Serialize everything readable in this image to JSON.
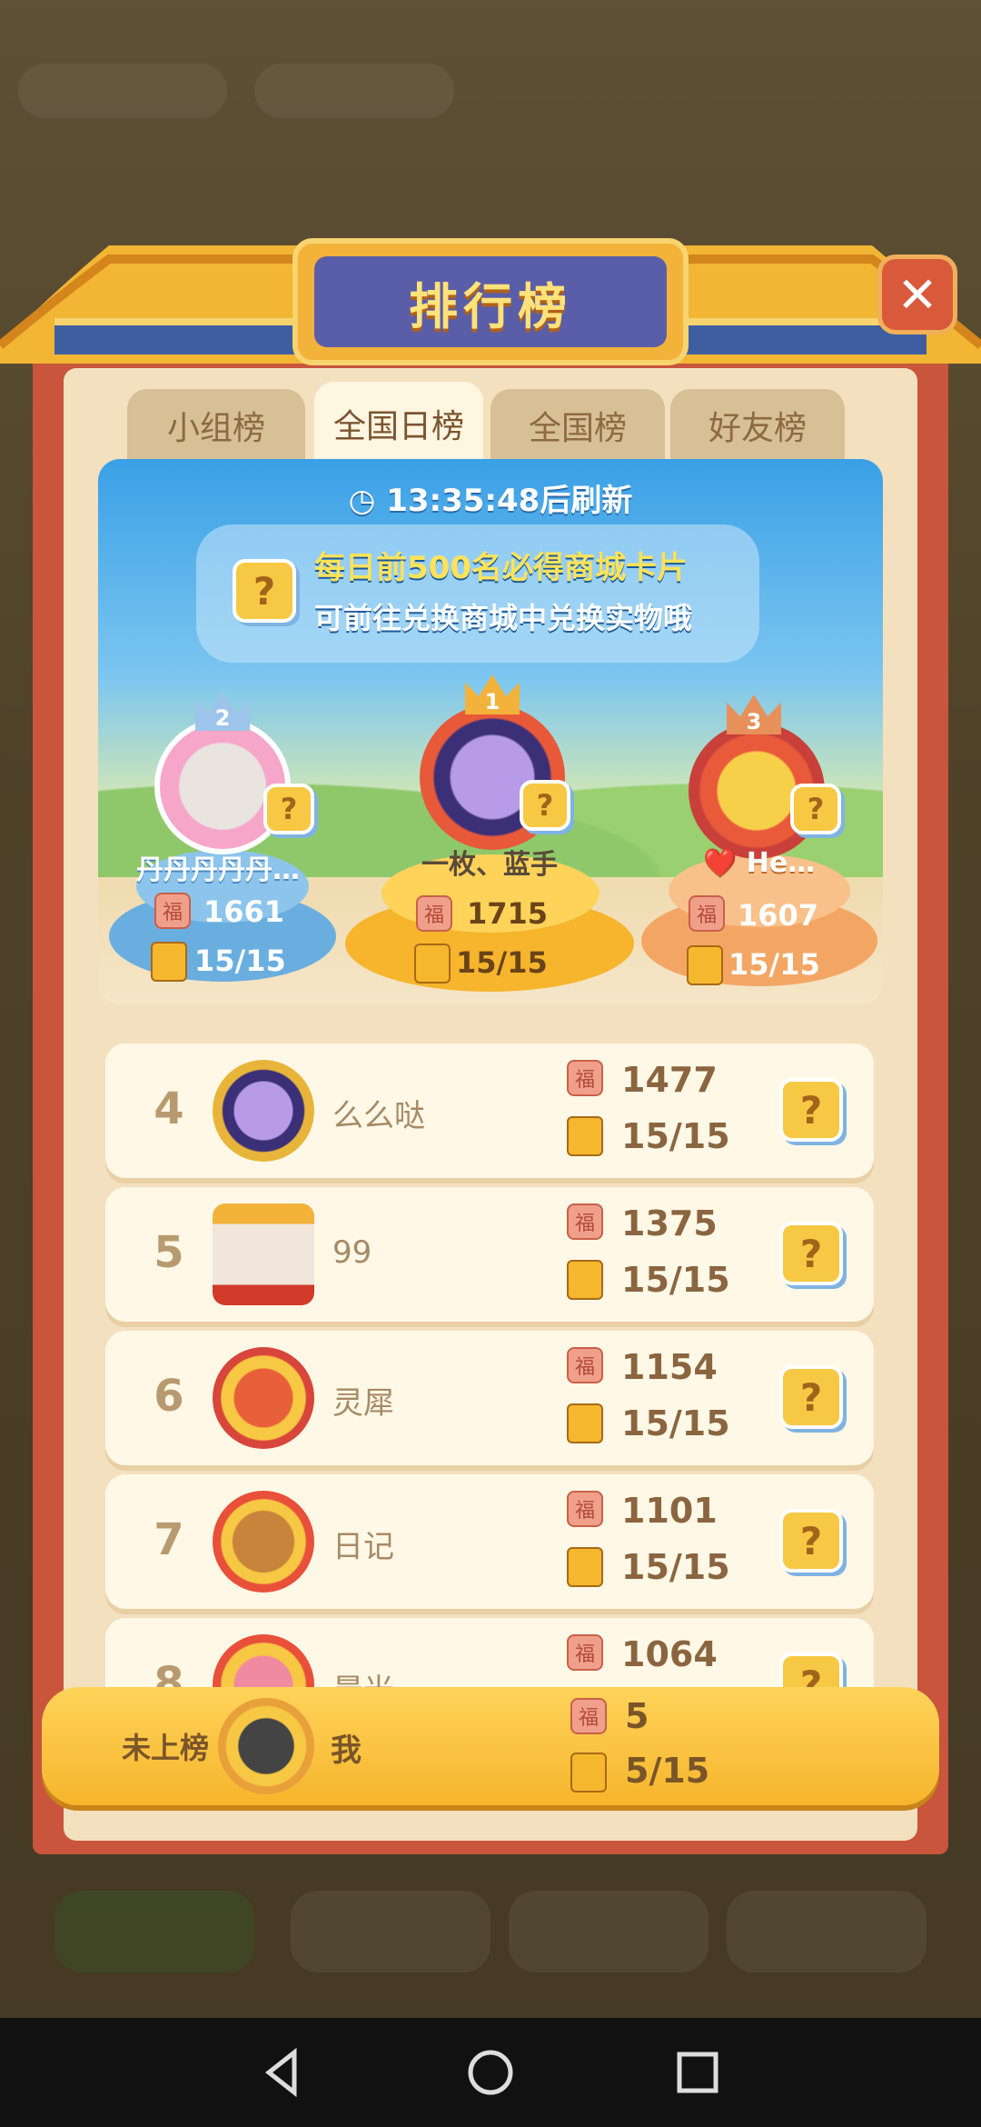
{
  "title": "排行榜",
  "close_label": "✕",
  "tabs": [
    {
      "label": "小组榜"
    },
    {
      "label": "全国日榜"
    },
    {
      "label": "全国榜"
    },
    {
      "label": "好友榜"
    }
  ],
  "refresh": "13:35:48后刷新",
  "notice": {
    "line1": "每日前500名必得商城卡片",
    "line2": "可前往兑换商城中兑换实物哦"
  },
  "question_mark": "?",
  "fu_char": "福",
  "podium": [
    {
      "rank": "2",
      "name": "丹丹丹丹丹…",
      "score": "1661",
      "progress": "15/15"
    },
    {
      "rank": "1",
      "name": "一枚、蓝手",
      "score": "1715",
      "progress": "15/15"
    },
    {
      "rank": "3",
      "name": "❤️ He…",
      "score": "1607",
      "progress": "15/15"
    }
  ],
  "rows": [
    {
      "rank": "4",
      "name": "么么哒",
      "score": "1477",
      "progress": "15/15"
    },
    {
      "rank": "5",
      "name": "99",
      "score": "1375",
      "progress": "15/15"
    },
    {
      "rank": "6",
      "name": "灵犀",
      "score": "1154",
      "progress": "15/15"
    },
    {
      "rank": "7",
      "name": "日记",
      "score": "1101",
      "progress": "15/15"
    },
    {
      "rank": "8",
      "name": "晨光",
      "score": "1064",
      "progress": ""
    }
  ],
  "me": {
    "rank_label": "未上榜",
    "name": "我",
    "score": "5",
    "progress": "5/15"
  },
  "colors": {
    "accent": "#f6b52c",
    "frame": "#c8553c",
    "title_plate": "#5a5ea9"
  },
  "icons": {
    "back": "back-triangle-icon",
    "home": "home-circle-icon",
    "recents": "recents-square-icon"
  }
}
